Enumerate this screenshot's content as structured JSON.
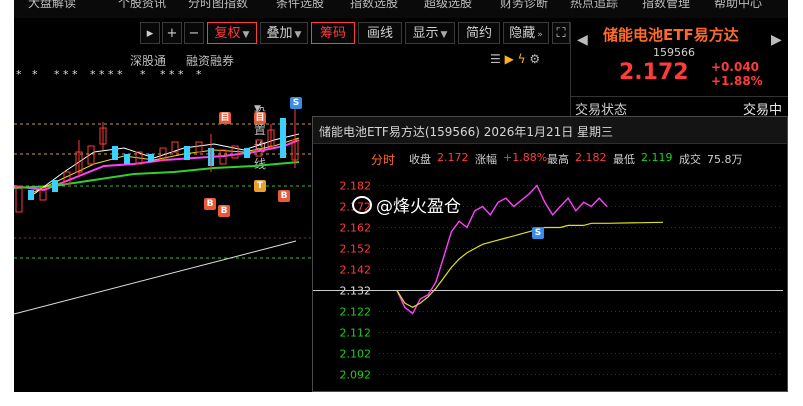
{
  "menubar": {
    "items": [
      "大盘解读",
      "个股资讯",
      "分时图指数",
      "条件选股",
      "指数选股",
      "超级选股",
      "财务诊断",
      "热点追踪",
      "指数管理",
      "帮助中心"
    ]
  },
  "toolbar": {
    "plus": "+",
    "minus": "−",
    "fuquan": "复权",
    "diejia": "叠加",
    "chouma": "筹码",
    "huaxian": "画线",
    "xianshi": "显示",
    "jianyue": "简约",
    "yincang": "隐藏",
    "expand": "⛶"
  },
  "subtabs": {
    "shengu": "深股通",
    "rongzi": "融资融券",
    "junxian": "设置均线"
  },
  "quote": {
    "name": "储能电池ETF易方达",
    "code": "159566",
    "price": "2.172",
    "change": "+0.040",
    "change_pct": "+1.88%",
    "status_label": "交易状态",
    "status_value": "交易中"
  },
  "popup": {
    "title": "储能电池ETF易方达(159566) 2026年1月21日 星期三",
    "tab": "分时",
    "close_label": "收盘",
    "close_value": "2.172",
    "amp_label": "涨幅",
    "amp_value": "+1.88%",
    "high_label": "最高",
    "high_value": "2.182",
    "low_label": "最低",
    "low_value": "2.119",
    "vol_label": "成交",
    "vol_value": "75.8万"
  },
  "watermark": "@烽火盈仓",
  "colors": {
    "accent_red": "#ff3b3b",
    "accent_orange": "#ff6a2b",
    "green": "#19d219",
    "yellow_line": "#e0e020",
    "magenta_line": "#ff40ff"
  },
  "badges": {
    "s": "S",
    "b": "B",
    "t": "T",
    "e": "目"
  },
  "chart_data": [
    {
      "type": "line",
      "title": "",
      "xlabel": "",
      "ylabel": "",
      "ylim": [
        2.087,
        2.187
      ],
      "y_ticks": [
        "2.182",
        "2.172",
        "2.162",
        "2.152",
        "2.142",
        "2.132",
        "2.122",
        "2.112",
        "2.102",
        "2.092"
      ],
      "prev_close": 2.132,
      "series": [
        {
          "values": [
            2.132,
            2.124,
            2.121,
            2.128,
            2.13,
            2.136,
            2.148,
            2.16,
            2.165,
            2.162,
            2.17,
            2.172,
            2.168,
            2.174,
            2.176,
            2.172,
            2.175,
            2.178,
            2.182,
            2.174,
            2.168,
            2.172,
            2.176,
            2.17,
            2.174,
            2.172,
            2.176,
            2.172
          ]
        },
        {
          "values": [
            2.132,
            2.126,
            2.124,
            2.126,
            2.129,
            2.133,
            2.138,
            2.143,
            2.147,
            2.15,
            2.152,
            2.154,
            2.155,
            2.156,
            2.157,
            2.158,
            2.159,
            2.16,
            2.161,
            2.162,
            2.162,
            2.162,
            2.163,
            2.163,
            2.163,
            2.164,
            2.164,
            2.164
          ]
        }
      ]
    }
  ]
}
